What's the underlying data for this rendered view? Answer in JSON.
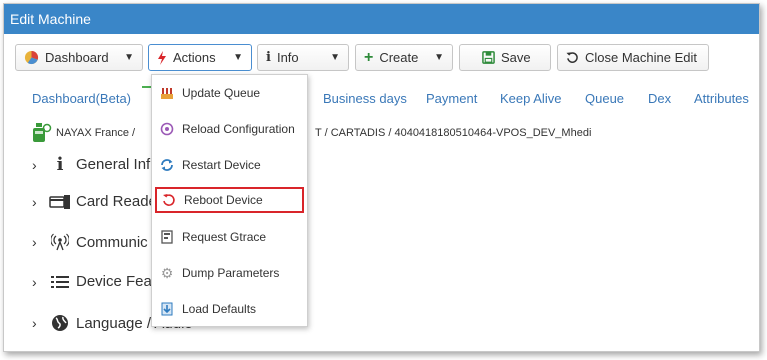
{
  "window": {
    "title": "Edit Machine"
  },
  "toolbar": {
    "dashboard_label": "Dashboard",
    "actions_label": "Actions",
    "info_label": "Info",
    "create_label": "Create",
    "save_label": "Save",
    "close_label": "Close Machine Edit"
  },
  "tabs": [
    {
      "label": "Dashboard(Beta)"
    },
    {
      "label": "Business days"
    },
    {
      "label": "Payment"
    },
    {
      "label": "Keep Alive"
    },
    {
      "label": "Queue"
    },
    {
      "label": "Dex"
    },
    {
      "label": "Attributes"
    }
  ],
  "breadcrumb": {
    "left": "NAYAX France /",
    "right": "T / CARTADIS / 4040418180510464-VPOS_DEV_Mhedi"
  },
  "tree": [
    {
      "label": "General Inf",
      "icon": "info-icon"
    },
    {
      "label": "Card Reade",
      "icon": "card-reader-icon"
    },
    {
      "label": "Communic",
      "icon": "antenna-icon"
    },
    {
      "label": "Device Fea",
      "icon": "list-icon"
    },
    {
      "label": "Language / Audio",
      "icon": "globe-icon"
    }
  ],
  "actions_menu": [
    {
      "label": "Update Queue",
      "icon": "queue-icon"
    },
    {
      "label": "Reload Configuration",
      "icon": "reload-config-icon"
    },
    {
      "label": "Restart Device",
      "icon": "restart-icon"
    },
    {
      "label": "Reboot Device",
      "icon": "reboot-icon",
      "highlighted": true
    },
    {
      "label": "Request Gtrace",
      "icon": "gtrace-icon"
    },
    {
      "label": "Dump Parameters",
      "icon": "gear-icon"
    },
    {
      "label": "Load Defaults",
      "icon": "download-icon"
    }
  ],
  "colors": {
    "title_bar": "#3a86c8",
    "tab_text": "#3a78b8",
    "highlight_border": "#d9252a",
    "active_indicator": "#4caf50"
  }
}
